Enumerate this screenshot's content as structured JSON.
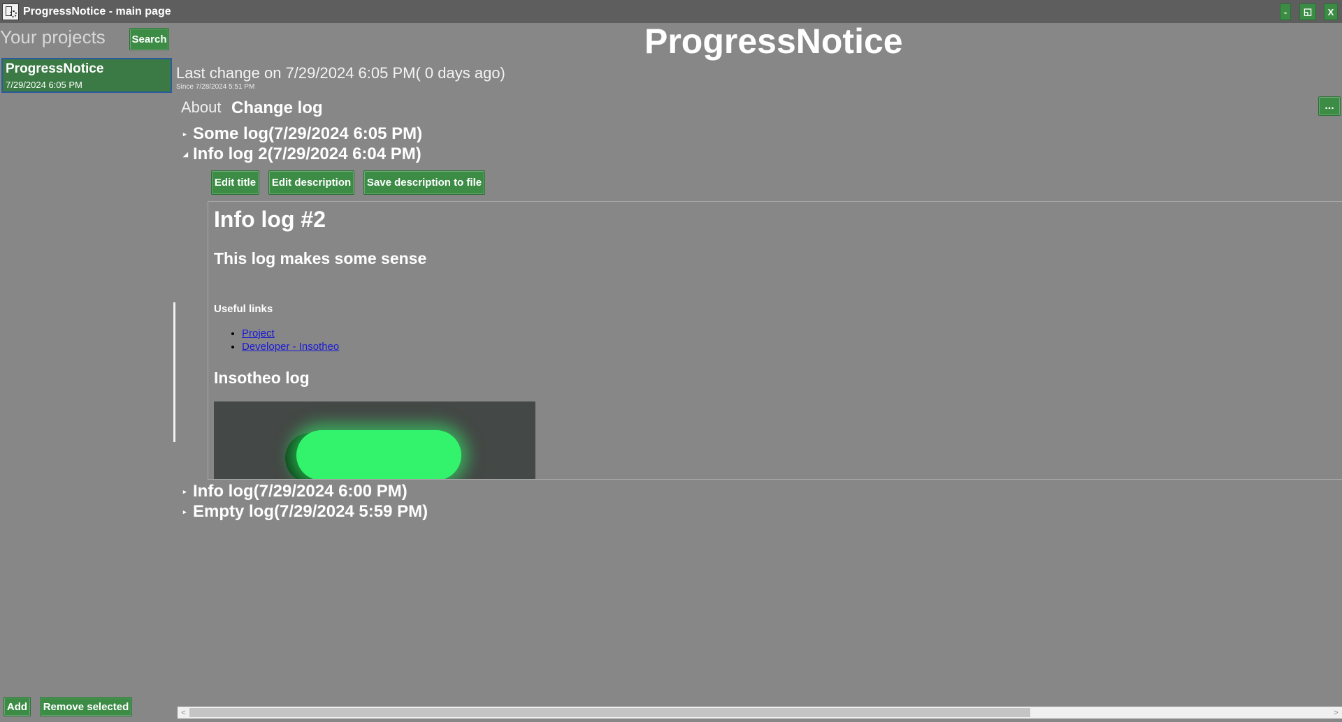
{
  "window": {
    "title": "ProgressNotice - main page",
    "minimize_label": "-",
    "maximize_label": "◱",
    "close_label": "X"
  },
  "sidebar": {
    "heading": "Your projects",
    "search_label": "Search",
    "projects": [
      {
        "name": "ProgressNotice",
        "date": "7/29/2024 6:05 PM"
      }
    ],
    "add_label": "Add",
    "remove_label": "Remove selected"
  },
  "main": {
    "app_title": "ProgressNotice",
    "last_change": "Last change on 7/29/2024 6:05 PM( 0 days ago)",
    "since": "Since 7/28/2024 5:51 PM",
    "tabs": [
      {
        "label": "About",
        "active": false
      },
      {
        "label": "Change log",
        "active": true
      }
    ],
    "more_label": "...",
    "logs": [
      {
        "title": "Some log(7/29/2024 6:05 PM)",
        "expanded": false
      },
      {
        "title": "Info log 2(7/29/2024 6:04 PM)",
        "expanded": true
      },
      {
        "title": "Info log(7/29/2024 6:00 PM)",
        "expanded": false
      },
      {
        "title": "Empty log(7/29/2024 5:59 PM)",
        "expanded": false
      }
    ],
    "expanded_log": {
      "edit_title_label": "Edit title",
      "edit_description_label": "Edit description",
      "save_description_label": "Save description to file",
      "description": {
        "h1": "Info log #2",
        "h2": "This log makes some sense",
        "links_heading": "Useful links",
        "links": [
          "Project",
          "Developer - Insotheo"
        ],
        "h3": "Insotheo log"
      }
    }
  },
  "scrollbar": {
    "left_arrow": "<",
    "right_arrow": ">"
  },
  "colors": {
    "background": "#878787",
    "titlebar": "#5e5e5e",
    "accent_green": "#3c8c46",
    "selected_project_border": "#2c5b9c",
    "link": "#1a1ad6",
    "logo_green": "#33f36c"
  }
}
